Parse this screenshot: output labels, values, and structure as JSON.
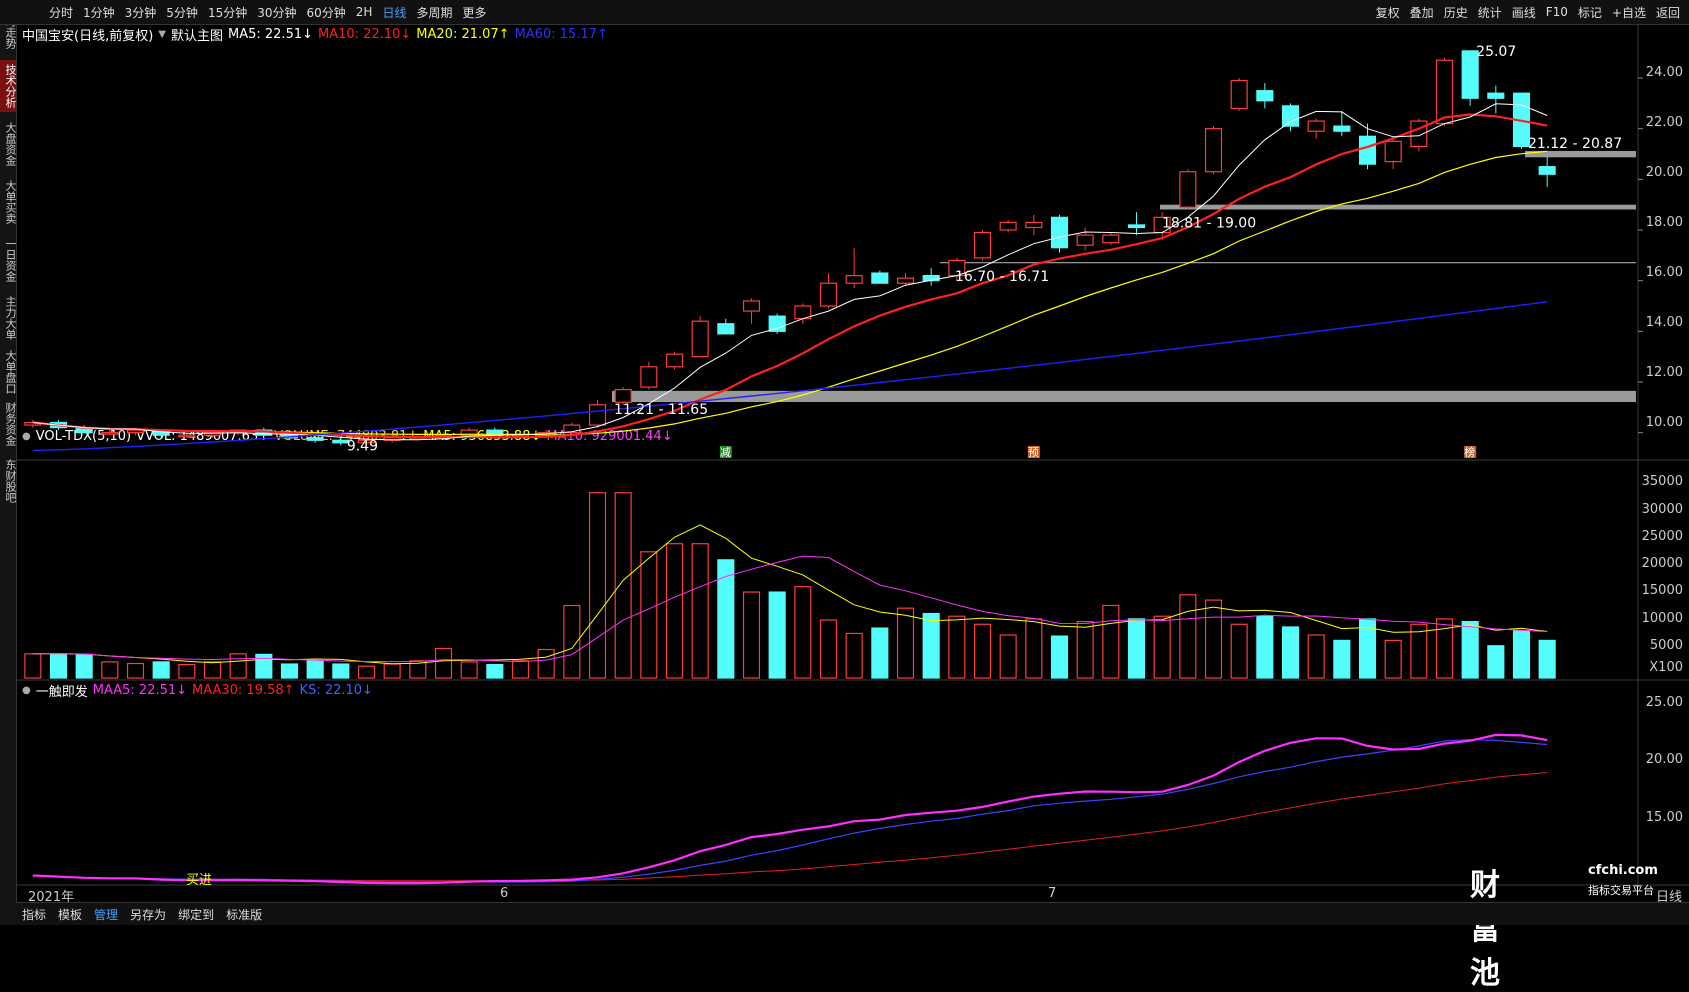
{
  "toolbar": {
    "left": [
      "分时",
      "1分钟",
      "3分钟",
      "5分钟",
      "15分钟",
      "30分钟",
      "60分钟",
      "2H",
      "日线",
      "多周期",
      "更多"
    ],
    "active": "日线",
    "right": [
      "复权",
      "叠加",
      "历史",
      "统计",
      "画线",
      "F10",
      "标记",
      "+自选",
      "返回"
    ]
  },
  "sidebar": [
    "分时走势",
    "技术分析",
    "大盘资金",
    "大单买卖",
    "一日资金",
    "主力大单",
    "大单盘口",
    "财务资金",
    "东财股吧"
  ],
  "sidebar_active": "技术分析",
  "main_header": {
    "stock": "中国宝安(日线,前复权)",
    "template": "默认主图",
    "ma5": "MA5: 22.51↓",
    "ma10": "MA10: 22.10↓",
    "ma20": "MA20: 21.07↑",
    "ma60": "MA60: 15.17↑"
  },
  "vol_header": {
    "name": "VOL-TDX(5,10)",
    "vvol": "VVOL: 1489607.63↑",
    "volume": "VOLUME: 744803.81↓",
    "ma5": "MA5: 936853.88↓",
    "ma10": "MA10: 929001.44↓"
  },
  "ind_header": {
    "name": "一触即发",
    "maa5": "MAA5: 22.51↓",
    "maa30": "MAA30: 19.58↑",
    "ks": "KS: 22.10↓"
  },
  "price_axis": [
    "24.00",
    "22.00",
    "20.00",
    "18.00",
    "16.00",
    "14.00",
    "12.00",
    "10.00"
  ],
  "vol_axis": [
    "35000",
    "30000",
    "25000",
    "20000",
    "15000",
    "10000",
    "5000",
    "X100"
  ],
  "ind_axis": [
    "25.00",
    "20.00",
    "15.00"
  ],
  "annotations": {
    "high": "25.07",
    "low": "9.49",
    "zone1": "11.21 - 11.65",
    "zone2": "16.70 - 16.71",
    "zone3": "18.81 - 19.00",
    "zone4": "21.12 - 20.87",
    "markers": [
      "减",
      "预",
      "榜"
    ],
    "buy_signal": "买进"
  },
  "time_axis": [
    "2021年",
    "6",
    "7"
  ],
  "period_label": "日线",
  "bottom_tabs": [
    "指标",
    "模板",
    "管理",
    "另存为",
    "绑定到",
    "标准版"
  ],
  "bottom_active": "管理",
  "watermark": {
    "brand": "财富池",
    "site": "cfchi.com",
    "slogan": "指标交易平台"
  },
  "colors": {
    "up": "#ff3b3b",
    "down": "#54fcfc",
    "ma5": "#ffffff",
    "ma10": "#ff2020",
    "ma20": "#ffff00",
    "ma60": "#2020ff",
    "magenta": "#ff30ff",
    "blue": "#4040ff"
  },
  "chart_data": {
    "type": "candlestick",
    "candles": [
      [
        10.3,
        10.5,
        10.2,
        10.4
      ],
      [
        10.4,
        10.5,
        10.1,
        10.2
      ],
      [
        10.2,
        10.3,
        10.0,
        10.0
      ],
      [
        10.0,
        10.1,
        9.9,
        10.0
      ],
      [
        10.0,
        10.2,
        9.9,
        10.1
      ],
      [
        10.1,
        10.1,
        9.8,
        9.9
      ],
      [
        9.9,
        10.0,
        9.8,
        9.9
      ],
      [
        9.9,
        10.1,
        9.8,
        10.0
      ],
      [
        10.0,
        10.1,
        9.9,
        10.1
      ],
      [
        10.1,
        10.2,
        9.9,
        9.9
      ],
      [
        9.9,
        10.0,
        9.7,
        9.8
      ],
      [
        9.8,
        9.9,
        9.6,
        9.7
      ],
      [
        9.7,
        9.8,
        9.49,
        9.6
      ],
      [
        9.6,
        9.8,
        9.5,
        9.7
      ],
      [
        9.7,
        9.9,
        9.6,
        9.8
      ],
      [
        9.8,
        9.9,
        9.7,
        9.8
      ],
      [
        9.8,
        10.0,
        9.7,
        9.9
      ],
      [
        9.9,
        10.2,
        9.8,
        10.1
      ],
      [
        10.1,
        10.2,
        9.9,
        9.9
      ],
      [
        9.9,
        10.0,
        9.8,
        9.9
      ],
      [
        9.9,
        10.1,
        9.8,
        10.0
      ],
      [
        10.0,
        10.4,
        9.9,
        10.3
      ],
      [
        10.3,
        11.3,
        10.2,
        11.1
      ],
      [
        11.2,
        11.8,
        11.1,
        11.7
      ],
      [
        11.8,
        12.8,
        11.7,
        12.6
      ],
      [
        12.6,
        13.2,
        12.5,
        13.1
      ],
      [
        13.0,
        14.6,
        13.0,
        14.4
      ],
      [
        14.3,
        14.5,
        13.9,
        13.9
      ],
      [
        14.8,
        15.3,
        14.3,
        15.2
      ],
      [
        14.6,
        14.7,
        13.9,
        14.0
      ],
      [
        14.5,
        15.1,
        14.3,
        15.0
      ],
      [
        15.0,
        16.3,
        14.9,
        15.9
      ],
      [
        15.9,
        17.3,
        15.7,
        16.2
      ],
      [
        16.3,
        16.4,
        15.9,
        15.9
      ],
      [
        15.9,
        16.3,
        15.8,
        16.1
      ],
      [
        16.2,
        16.5,
        15.8,
        16.0
      ],
      [
        16.2,
        16.9,
        16.0,
        16.8
      ],
      [
        16.9,
        18.0,
        16.8,
        17.9
      ],
      [
        18.0,
        18.4,
        17.9,
        18.3
      ],
      [
        18.1,
        18.6,
        17.8,
        18.3
      ],
      [
        18.5,
        18.6,
        17.1,
        17.3
      ],
      [
        17.4,
        18.1,
        17.2,
        17.8
      ],
      [
        17.5,
        17.9,
        17.4,
        17.8
      ],
      [
        18.2,
        18.7,
        17.8,
        18.1
      ],
      [
        17.9,
        18.7,
        17.6,
        18.5
      ],
      [
        18.9,
        20.4,
        18.8,
        20.3
      ],
      [
        20.3,
        22.1,
        20.2,
        22.0
      ],
      [
        22.8,
        24.0,
        22.7,
        23.9
      ],
      [
        23.5,
        23.8,
        22.8,
        23.1
      ],
      [
        22.9,
        23.0,
        21.9,
        22.1
      ],
      [
        21.9,
        22.4,
        21.6,
        22.3
      ],
      [
        22.1,
        22.7,
        21.7,
        21.9
      ],
      [
        21.7,
        22.2,
        20.4,
        20.6
      ],
      [
        20.7,
        21.7,
        20.4,
        21.5
      ],
      [
        21.3,
        22.4,
        21.1,
        22.3
      ],
      [
        22.2,
        24.8,
        22.1,
        24.7
      ],
      [
        25.07,
        25.07,
        22.9,
        23.2
      ],
      [
        23.4,
        23.7,
        22.6,
        23.2
      ],
      [
        23.4,
        23.4,
        21.2,
        21.3
      ],
      [
        20.5,
        20.9,
        19.7,
        20.2
      ]
    ],
    "volume_x100": [
      4500,
      4500,
      4400,
      3000,
      2700,
      3000,
      2500,
      3000,
      4500,
      4400,
      2600,
      3200,
      2600,
      2200,
      2600,
      3200,
      5500,
      3000,
      2500,
      3200,
      5300,
      13500,
      34500,
      34500,
      23500,
      25000,
      25000,
      22000,
      16000,
      16000,
      17000,
      10800,
      8300,
      9300,
      13000,
      12000,
      11500,
      10000,
      8000,
      11000,
      7800,
      10500,
      13500,
      11000,
      11500,
      15500,
      14500,
      10000,
      11500,
      9500,
      8000,
      7000,
      11000,
      7000,
      10000,
      11000,
      10500,
      6000,
      8800,
      7000
    ],
    "ylim_price": [
      9.0,
      25.5
    ],
    "ylim_volume": [
      0,
      35000
    ],
    "ylim_indicator": [
      10,
      27
    ]
  }
}
